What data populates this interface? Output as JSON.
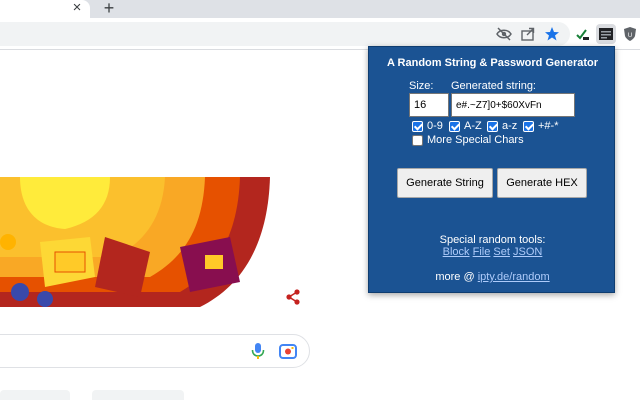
{
  "browser": {
    "tab_close_glyph": "×",
    "new_tab_glyph": "+"
  },
  "popup": {
    "title": "A Random String & Password Generator",
    "size_label": "Size:",
    "size_value": "16",
    "generated_label": "Generated string:",
    "generated_value": "e#.~Z7]0+$60XvFn",
    "options": [
      {
        "label": "0-9",
        "checked": true
      },
      {
        "label": "A-Z",
        "checked": true
      },
      {
        "label": "a-z",
        "checked": true
      },
      {
        "label": "+#-*",
        "checked": true
      }
    ],
    "more_special": {
      "label": "More Special Chars",
      "checked": false
    },
    "generate_string_label": "Generate String",
    "generate_hex_label": "Generate HEX",
    "tools_title": "Special random tools:",
    "tools_links": [
      "Block",
      "File",
      "Set",
      "JSON"
    ],
    "more_prefix": "more @",
    "more_link": "ipty.de/random"
  },
  "colors": {
    "popup_bg": "#1b5393",
    "bookmark_star": "#1a73e8",
    "share": "#c5221f",
    "mic_blue": "#4285f4",
    "mic_red": "#ea4335"
  }
}
